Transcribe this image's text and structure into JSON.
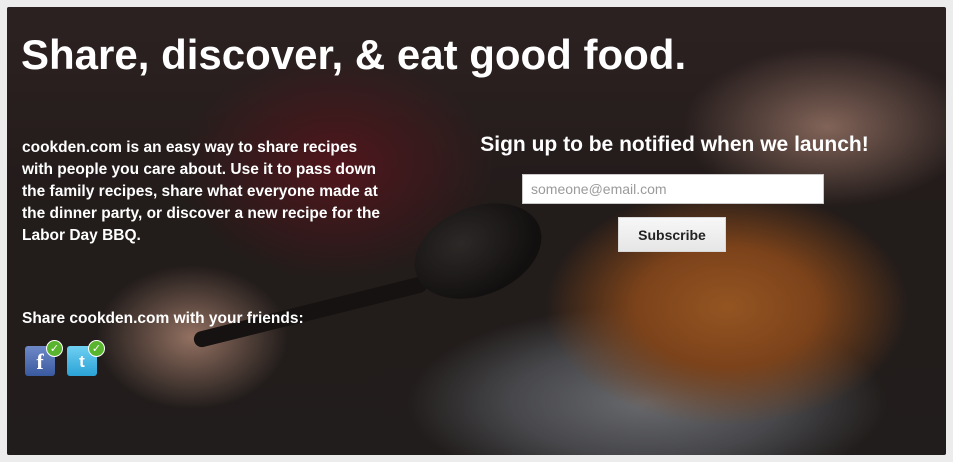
{
  "hero": {
    "headline": "Share, discover, & eat good food.",
    "description": "cookden.com is an easy way to share recipes with people you care about. Use it to pass down the family recipes, share what everyone made at the dinner party, or discover a new recipe for the Labor Day BBQ."
  },
  "share": {
    "label": "Share cookden.com with your friends:",
    "facebook": {
      "glyph": "f",
      "icon": "facebook-icon",
      "checked": true,
      "color": "#3b5998"
    },
    "twitter": {
      "glyph": "t",
      "icon": "twitter-icon",
      "checked": true,
      "color": "#2aa2d6"
    },
    "check_glyph": "✓"
  },
  "signup": {
    "title": "Sign up to be notified when we launch!",
    "email_placeholder": "someone@email.com",
    "email_value": "",
    "button_label": "Subscribe"
  }
}
